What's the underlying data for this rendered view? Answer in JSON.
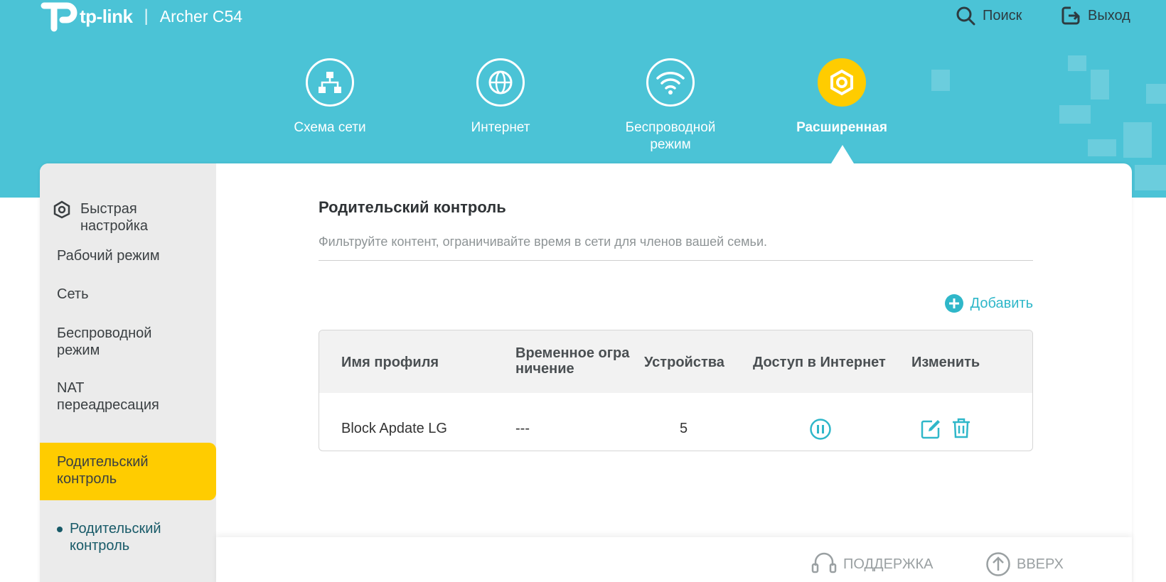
{
  "header": {
    "brand": "tp-link",
    "separator": "|",
    "model": "Archer C54",
    "search_label": "Поиск",
    "logout_label": "Выход"
  },
  "nav": {
    "items": [
      {
        "label": "Схема сети",
        "icon": "network-map-icon"
      },
      {
        "label": "Интернет",
        "icon": "globe-icon"
      },
      {
        "label": "Беспроводной режим",
        "icon": "wifi-icon"
      },
      {
        "label": "Расширенная",
        "icon": "gear-icon",
        "active": true
      }
    ]
  },
  "sidebar": {
    "items": [
      {
        "label": "Быстрая настройка",
        "icon": "gear-icon"
      },
      {
        "label": "Рабочий режим"
      },
      {
        "label": "Сеть"
      },
      {
        "label": "Беспроводной режим"
      },
      {
        "label": "NAT переадресация"
      },
      {
        "label": "Родительский контроль",
        "active": true
      }
    ],
    "sub_items": [
      {
        "label": "Родительский контроль"
      }
    ]
  },
  "main": {
    "title": "Родительский контроль",
    "subtitle": "Фильтруйте контент, ограничивайте время в сети для членов вашей семьи.",
    "add_label": "Добавить",
    "table": {
      "headers": [
        "Имя профиля",
        "Временное огра ничение",
        "Устройства",
        "Доступ в Интернет",
        "Изменить"
      ],
      "rows": [
        {
          "name": "Block Apdate LG",
          "time_limit": "---",
          "devices": "5",
          "access_icon": "pause-icon",
          "edit_icons": [
            "edit-icon",
            "trash-icon"
          ]
        }
      ]
    }
  },
  "footer": {
    "support_label": "ПОДДЕРЖКА",
    "top_label": "ВВЕРХ"
  },
  "colors": {
    "header_bg": "#4bc3d6",
    "accent": "#ffcc00",
    "link": "#2fb7c9",
    "sidebar_bg": "#ebebeb"
  }
}
